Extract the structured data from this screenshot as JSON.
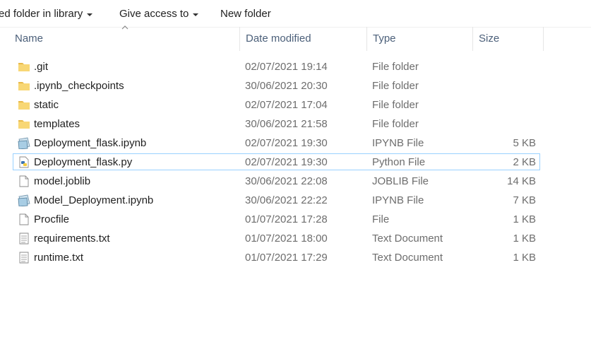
{
  "toolbar": {
    "include_label": "ed folder in library",
    "give_access_label": "Give access to",
    "new_folder_label": "New folder"
  },
  "columns": {
    "name": "Name",
    "date": "Date modified",
    "type": "Type",
    "size": "Size"
  },
  "files": [
    {
      "name": ".git",
      "date": "02/07/2021 19:14",
      "type": "File folder",
      "size": "",
      "icon": "folder-icon"
    },
    {
      "name": ".ipynb_checkpoints",
      "date": "30/06/2021 20:30",
      "type": "File folder",
      "size": "",
      "icon": "folder-icon"
    },
    {
      "name": "static",
      "date": "02/07/2021 17:04",
      "type": "File folder",
      "size": "",
      "icon": "folder-icon"
    },
    {
      "name": "templates",
      "date": "30/06/2021 21:58",
      "type": "File folder",
      "size": "",
      "icon": "folder-icon"
    },
    {
      "name": "Deployment_flask.ipynb",
      "date": "02/07/2021 19:30",
      "type": "IPYNB File",
      "size": "5 KB",
      "icon": "notebook-icon"
    },
    {
      "name": "Deployment_flask.py",
      "date": "02/07/2021 19:30",
      "type": "Python File",
      "size": "2 KB",
      "icon": "python-file-icon",
      "selected": true
    },
    {
      "name": "model.joblib",
      "date": "30/06/2021 22:08",
      "type": "JOBLIB File",
      "size": "14 KB",
      "icon": "blank-file-icon"
    },
    {
      "name": "Model_Deployment.ipynb",
      "date": "30/06/2021 22:22",
      "type": "IPYNB File",
      "size": "7 KB",
      "icon": "notebook-icon"
    },
    {
      "name": "Procfile",
      "date": "01/07/2021 17:28",
      "type": "File",
      "size": "1 KB",
      "icon": "blank-file-icon"
    },
    {
      "name": "requirements.txt",
      "date": "01/07/2021 18:00",
      "type": "Text Document",
      "size": "1 KB",
      "icon": "text-file-icon"
    },
    {
      "name": "runtime.txt",
      "date": "01/07/2021 17:29",
      "type": "Text Document",
      "size": "1 KB",
      "icon": "text-file-icon"
    }
  ],
  "colors": {
    "selection_border": "#99d1ff",
    "folder": "#f8d775",
    "header_text": "#4c607a"
  }
}
